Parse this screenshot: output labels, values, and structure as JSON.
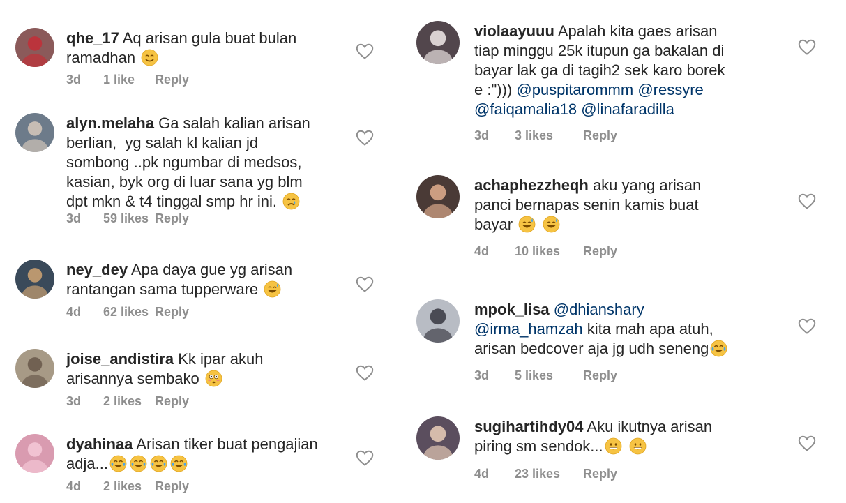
{
  "left": [
    {
      "user": "qhe_17",
      "text": [
        {
          "t": "Aq arisan gula buat bulan\nramadhan "
        },
        {
          "e": "smile"
        }
      ],
      "time": "3d",
      "likes": "1 like",
      "reply": "Reply",
      "avatar": {
        "bg": "#8b5a5a",
        "fg": "#c03038"
      }
    },
    {
      "user": "alyn.melaha",
      "text": [
        {
          "t": "Ga salah kalian arisan\nberlian,  yg salah kl kalian jd\nsombong ..pk ngumbar di medsos,\nkasian, byk org di luar sana yg blm\ndpt mkn & t4 tinggal smp hr ini. "
        },
        {
          "e": "cry"
        }
      ],
      "time": "3d",
      "likes": "59 likes",
      "reply": "Reply",
      "avatar": {
        "bg": "#6d7b8a",
        "fg": "#d0c4b8"
      }
    },
    {
      "user": "ney_dey",
      "text": [
        {
          "t": "Apa daya gue yg arisan\nrantangan sama tupperware "
        },
        {
          "e": "sweat"
        }
      ],
      "time": "4d",
      "likes": "62 likes",
      "reply": "Reply",
      "avatar": {
        "bg": "#3a4a5a",
        "fg": "#c9a071"
      }
    },
    {
      "user": "joise_andistira",
      "text": [
        {
          "t": "Kk ipar akuh\narisannya sembako "
        },
        {
          "e": "flushed"
        }
      ],
      "time": "3d",
      "likes": "2 likes",
      "reply": "Reply",
      "avatar": {
        "bg": "#a79a86",
        "fg": "#6b5b4d"
      }
    },
    {
      "user": "dyahinaa",
      "text": [
        {
          "t": "Arisan tiker buat pengajian\nadja..."
        },
        {
          "e": "joy"
        },
        {
          "e": "joy"
        },
        {
          "e": "joy"
        },
        {
          "e": "joy"
        }
      ],
      "time": "4d",
      "likes": "2 likes",
      "reply": "Reply",
      "avatar": {
        "bg": "#d99bb0",
        "fg": "#f3c6d6"
      }
    }
  ],
  "right": [
    {
      "user": "violaayuuu",
      "text": [
        {
          "t": "Apalah kita gaes arisan\ntiap minggu 25k itupun ga bakalan di\nbayar lak ga di tagih2 sek karo borek\ne :\"))) "
        },
        {
          "m": "@puspitarommm"
        },
        {
          "t": " "
        },
        {
          "m": "@ressyre"
        },
        {
          "t": "\n"
        },
        {
          "m": "@faiqamalia18"
        },
        {
          "t": " "
        },
        {
          "m": "@linafaradilla"
        }
      ],
      "time": "3d",
      "likes": "3 likes",
      "reply": "Reply",
      "avatar": {
        "bg": "#52464c",
        "fg": "#e8e0e0"
      }
    },
    {
      "user": "achaphezzheqh",
      "text": [
        {
          "t": "aku yang arisan\npanci bernapas senin kamis buat\nbayar "
        },
        {
          "e": "sweat"
        },
        {
          "t": " "
        },
        {
          "e": "sweat"
        }
      ],
      "time": "4d",
      "likes": "10 likes",
      "reply": "Reply",
      "avatar": {
        "bg": "#4a3a36",
        "fg": "#d9a88a"
      }
    },
    {
      "user": "mpok_lisa",
      "text": [
        {
          "m": "@dhianshary"
        },
        {
          "t": "\n"
        },
        {
          "m": "@irma_hamzah"
        },
        {
          "t": " kita mah apa atuh,\narisan bedcover aja jg udh seneng"
        },
        {
          "e": "joy"
        }
      ],
      "time": "3d",
      "likes": "5 likes",
      "reply": "Reply",
      "avatar": {
        "bg": "#b8bcc4",
        "fg": "#3e3e48"
      }
    },
    {
      "user": "sugihartihdy04",
      "text": [
        {
          "t": "Aku ikutnya arisan\npiring sm sendok..."
        },
        {
          "e": "grin"
        },
        {
          "t": " "
        },
        {
          "e": "grin"
        }
      ],
      "time": "4d",
      "likes": "23 likes",
      "reply": "Reply",
      "avatar": {
        "bg": "#5b4e5e",
        "fg": "#e2c8b4"
      }
    }
  ],
  "heart_color": "#8e8e8e",
  "mention_color": "#003569"
}
